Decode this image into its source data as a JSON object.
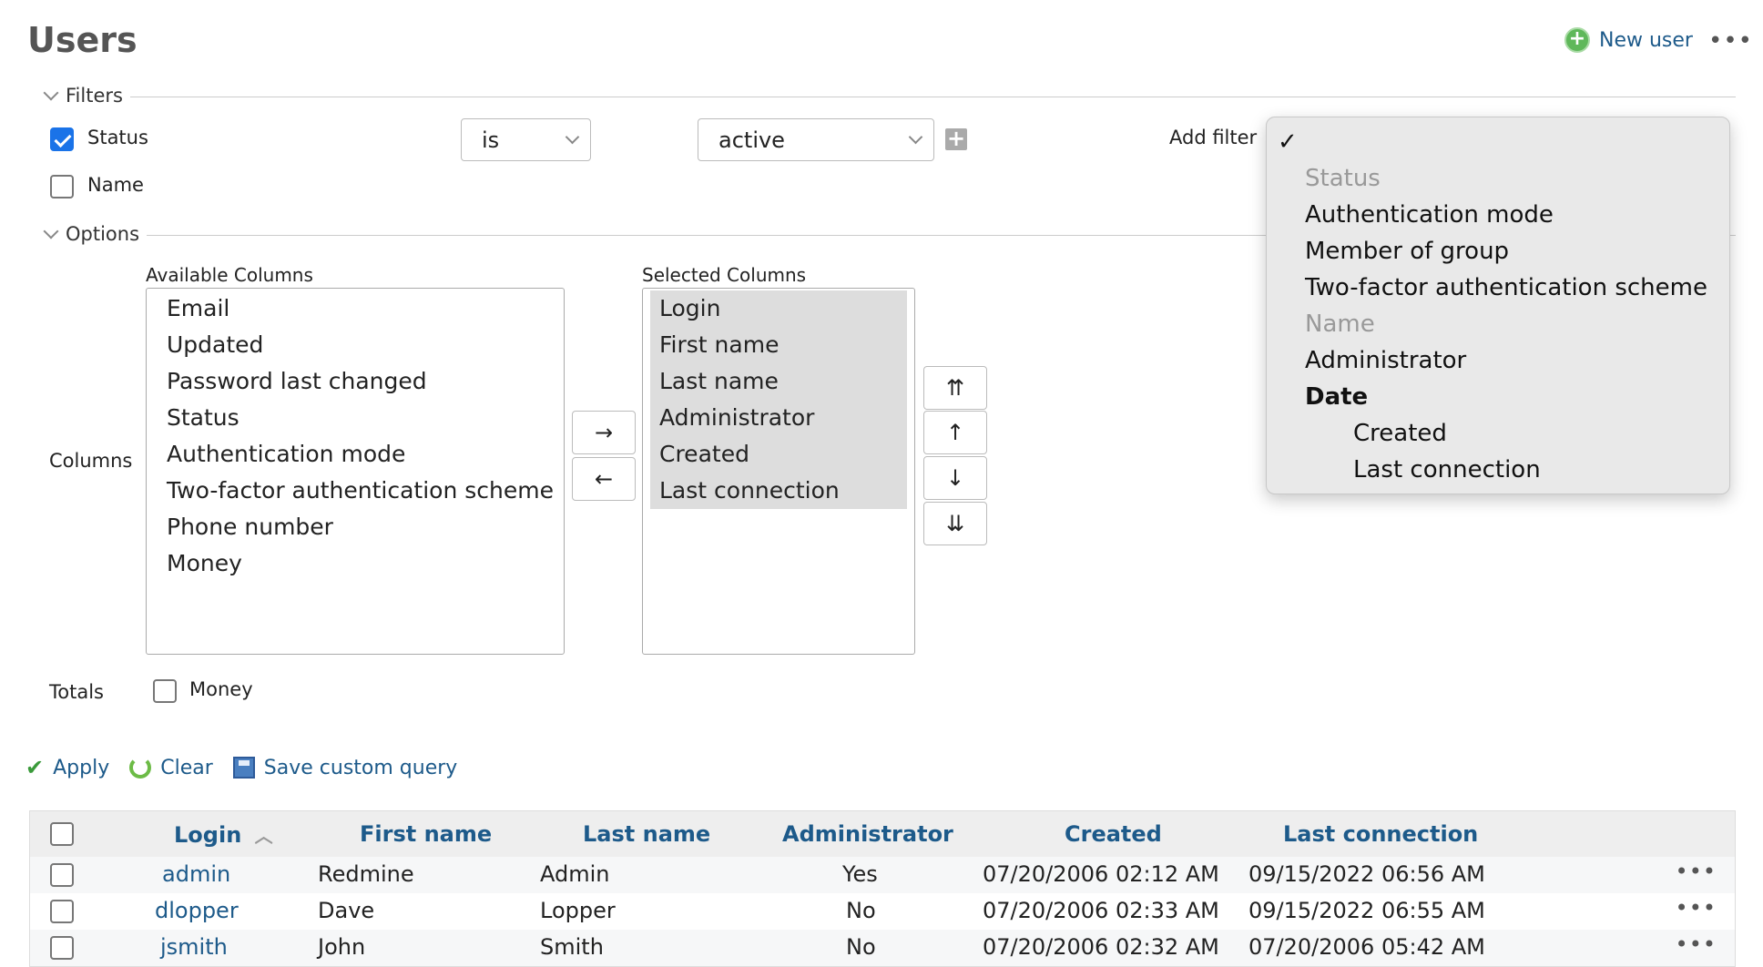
{
  "page": {
    "title": "Users"
  },
  "header_actions": {
    "new_user_label": "New user",
    "more_label": "•••"
  },
  "filters": {
    "legend": "Filters",
    "status": {
      "label": "Status",
      "checked": true,
      "operator": "is",
      "value": "active"
    },
    "name": {
      "label": "Name",
      "checked": false
    },
    "add_filter_label": "Add filter"
  },
  "options": {
    "legend": "Options",
    "columns_label": "Columns",
    "available_label": "Available Columns",
    "available": [
      "Email",
      "Updated",
      "Password last changed",
      "Status",
      "Authentication mode",
      "Two-factor authentication scheme",
      "Phone number",
      "Money"
    ],
    "selected_label": "Selected Columns",
    "selected": [
      "Login",
      "First name",
      "Last name",
      "Administrator",
      "Created",
      "Last connection"
    ],
    "move_right": "→",
    "move_left": "←",
    "move_top": "⇈",
    "move_up": "↑",
    "move_down": "↓",
    "move_bottom": "⇊",
    "totals_label": "Totals",
    "totals_money_label": "Money"
  },
  "actions": {
    "apply": "Apply",
    "clear": "Clear",
    "save": "Save custom query"
  },
  "table": {
    "headers": {
      "login": "Login",
      "sort_indicator": "︿",
      "first_name": "First name",
      "last_name": "Last name",
      "administrator": "Administrator",
      "created": "Created",
      "last_connection": "Last connection"
    },
    "rows": [
      {
        "login": "admin",
        "first_name": "Redmine",
        "last_name": "Admin",
        "administrator": "Yes",
        "created": "07/20/2006 02:12 AM",
        "last_connection": "09/15/2022 06:56 AM"
      },
      {
        "login": "dlopper",
        "first_name": "Dave",
        "last_name": "Lopper",
        "administrator": "No",
        "created": "07/20/2006 02:33 AM",
        "last_connection": "09/15/2022 06:55 AM"
      },
      {
        "login": "jsmith",
        "first_name": "John",
        "last_name": "Smith",
        "administrator": "No",
        "created": "07/20/2006 02:32 AM",
        "last_connection": "07/20/2006 05:42 AM"
      }
    ],
    "row_menu": "•••"
  },
  "add_filter_menu": {
    "checkmark": "✓",
    "items": [
      {
        "label": "Status",
        "kind": "disabled"
      },
      {
        "label": "Authentication mode",
        "kind": "option"
      },
      {
        "label": "Member of group",
        "kind": "option"
      },
      {
        "label": "Two-factor authentication scheme",
        "kind": "option"
      },
      {
        "label": "Name",
        "kind": "disabled"
      },
      {
        "label": "Administrator",
        "kind": "option"
      },
      {
        "label": "Date",
        "kind": "group"
      },
      {
        "label": "Created",
        "kind": "sub-option"
      },
      {
        "label": "Last connection",
        "kind": "sub-option"
      }
    ]
  },
  "colors": {
    "link": "#1d5a8a",
    "checkbox_checked": "#1a73e8",
    "selected_bg": "#dddddd",
    "table_header_bg": "#eeeeee"
  }
}
